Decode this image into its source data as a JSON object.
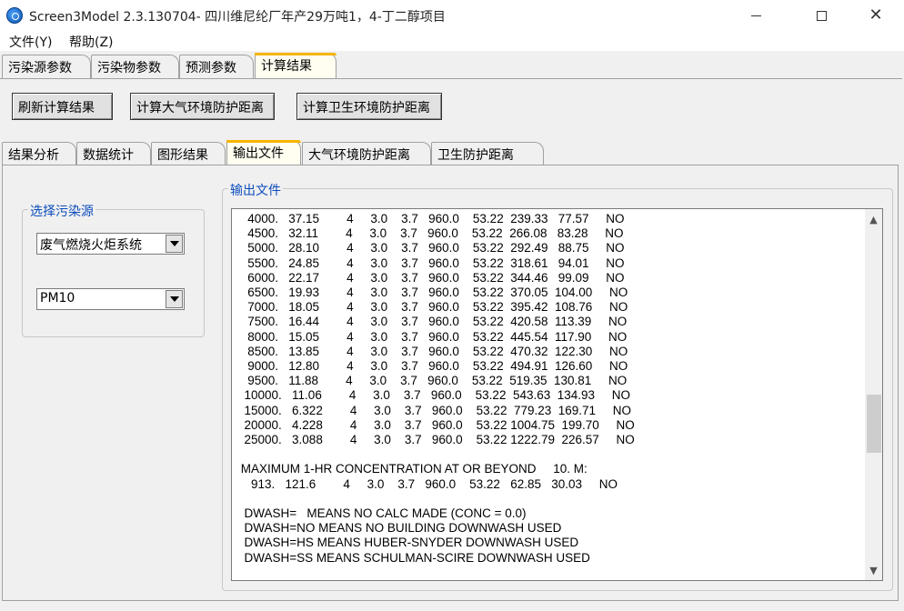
{
  "window": {
    "title": "Screen3Model 2.3.130704- 四川维尼纶厂年产29万吨1，4-丁二醇项目"
  },
  "menu": {
    "file": "文件(Y)",
    "help": "帮助(Z)"
  },
  "tabs_top": [
    {
      "label": "污染源参数"
    },
    {
      "label": "污染物参数"
    },
    {
      "label": "预测参数"
    },
    {
      "label": "计算结果"
    }
  ],
  "buttons": {
    "refresh": "刷新计算结果",
    "air": "计算大气环境防护距离",
    "hygiene": "计算卫生环境防护距离"
  },
  "tabs_sub": [
    {
      "label": "结果分析"
    },
    {
      "label": "数据统计"
    },
    {
      "label": "图形结果"
    },
    {
      "label": "输出文件"
    },
    {
      "label": "大气环境防护距离"
    },
    {
      "label": "卫生防护距离"
    }
  ],
  "source_group": {
    "legend": "选择污染源",
    "source_value": "废气燃烧火炬系统",
    "pollutant_value": "PM10"
  },
  "output_group": {
    "legend": "输出文件",
    "lines": [
      "   4000.   37.15        4     3.0    3.7   960.0    53.22  239.33   77.57     NO",
      "   4500.   32.11        4     3.0    3.7   960.0    53.22  266.08   83.28     NO",
      "   5000.   28.10        4     3.0    3.7   960.0    53.22  292.49   88.75     NO",
      "   5500.   24.85        4     3.0    3.7   960.0    53.22  318.61   94.01     NO",
      "   6000.   22.17        4     3.0    3.7   960.0    53.22  344.46   99.09     NO",
      "   6500.   19.93        4     3.0    3.7   960.0    53.22  370.05  104.00     NO",
      "   7000.   18.05        4     3.0    3.7   960.0    53.22  395.42  108.76     NO",
      "   7500.   16.44        4     3.0    3.7   960.0    53.22  420.58  113.39     NO",
      "   8000.   15.05        4     3.0    3.7   960.0    53.22  445.54  117.90     NO",
      "   8500.   13.85        4     3.0    3.7   960.0    53.22  470.32  122.30     NO",
      "   9000.   12.80        4     3.0    3.7   960.0    53.22  494.91  126.60     NO",
      "   9500.   11.88        4     3.0    3.7   960.0    53.22  519.35  130.81     NO",
      "  10000.   11.06        4     3.0    3.7   960.0    53.22  543.63  134.93     NO",
      "  15000.   6.322        4     3.0    3.7   960.0    53.22  779.23  169.71     NO",
      "  20000.   4.228        4     3.0    3.7   960.0    53.22 1004.75  199.70     NO",
      "  25000.   3.088        4     3.0    3.7   960.0    53.22 1222.79  226.57     NO",
      "",
      " MAXIMUM 1-HR CONCENTRATION AT OR BEYOND     10. M:",
      "    913.   121.6        4     3.0    3.7   960.0    53.22   62.85   30.03     NO",
      "",
      "  DWASH=   MEANS NO CALC MADE (CONC = 0.0)",
      "  DWASH=NO MEANS NO BUILDING DOWNWASH USED",
      "  DWASH=HS MEANS HUBER-SNYDER DOWNWASH USED",
      "  DWASH=SS MEANS SCHULMAN-SCIRE DOWNWASH USED"
    ]
  },
  "colors": {
    "legend_blue": "#0d4dbd",
    "active_tab_accent": "#f5b400"
  }
}
